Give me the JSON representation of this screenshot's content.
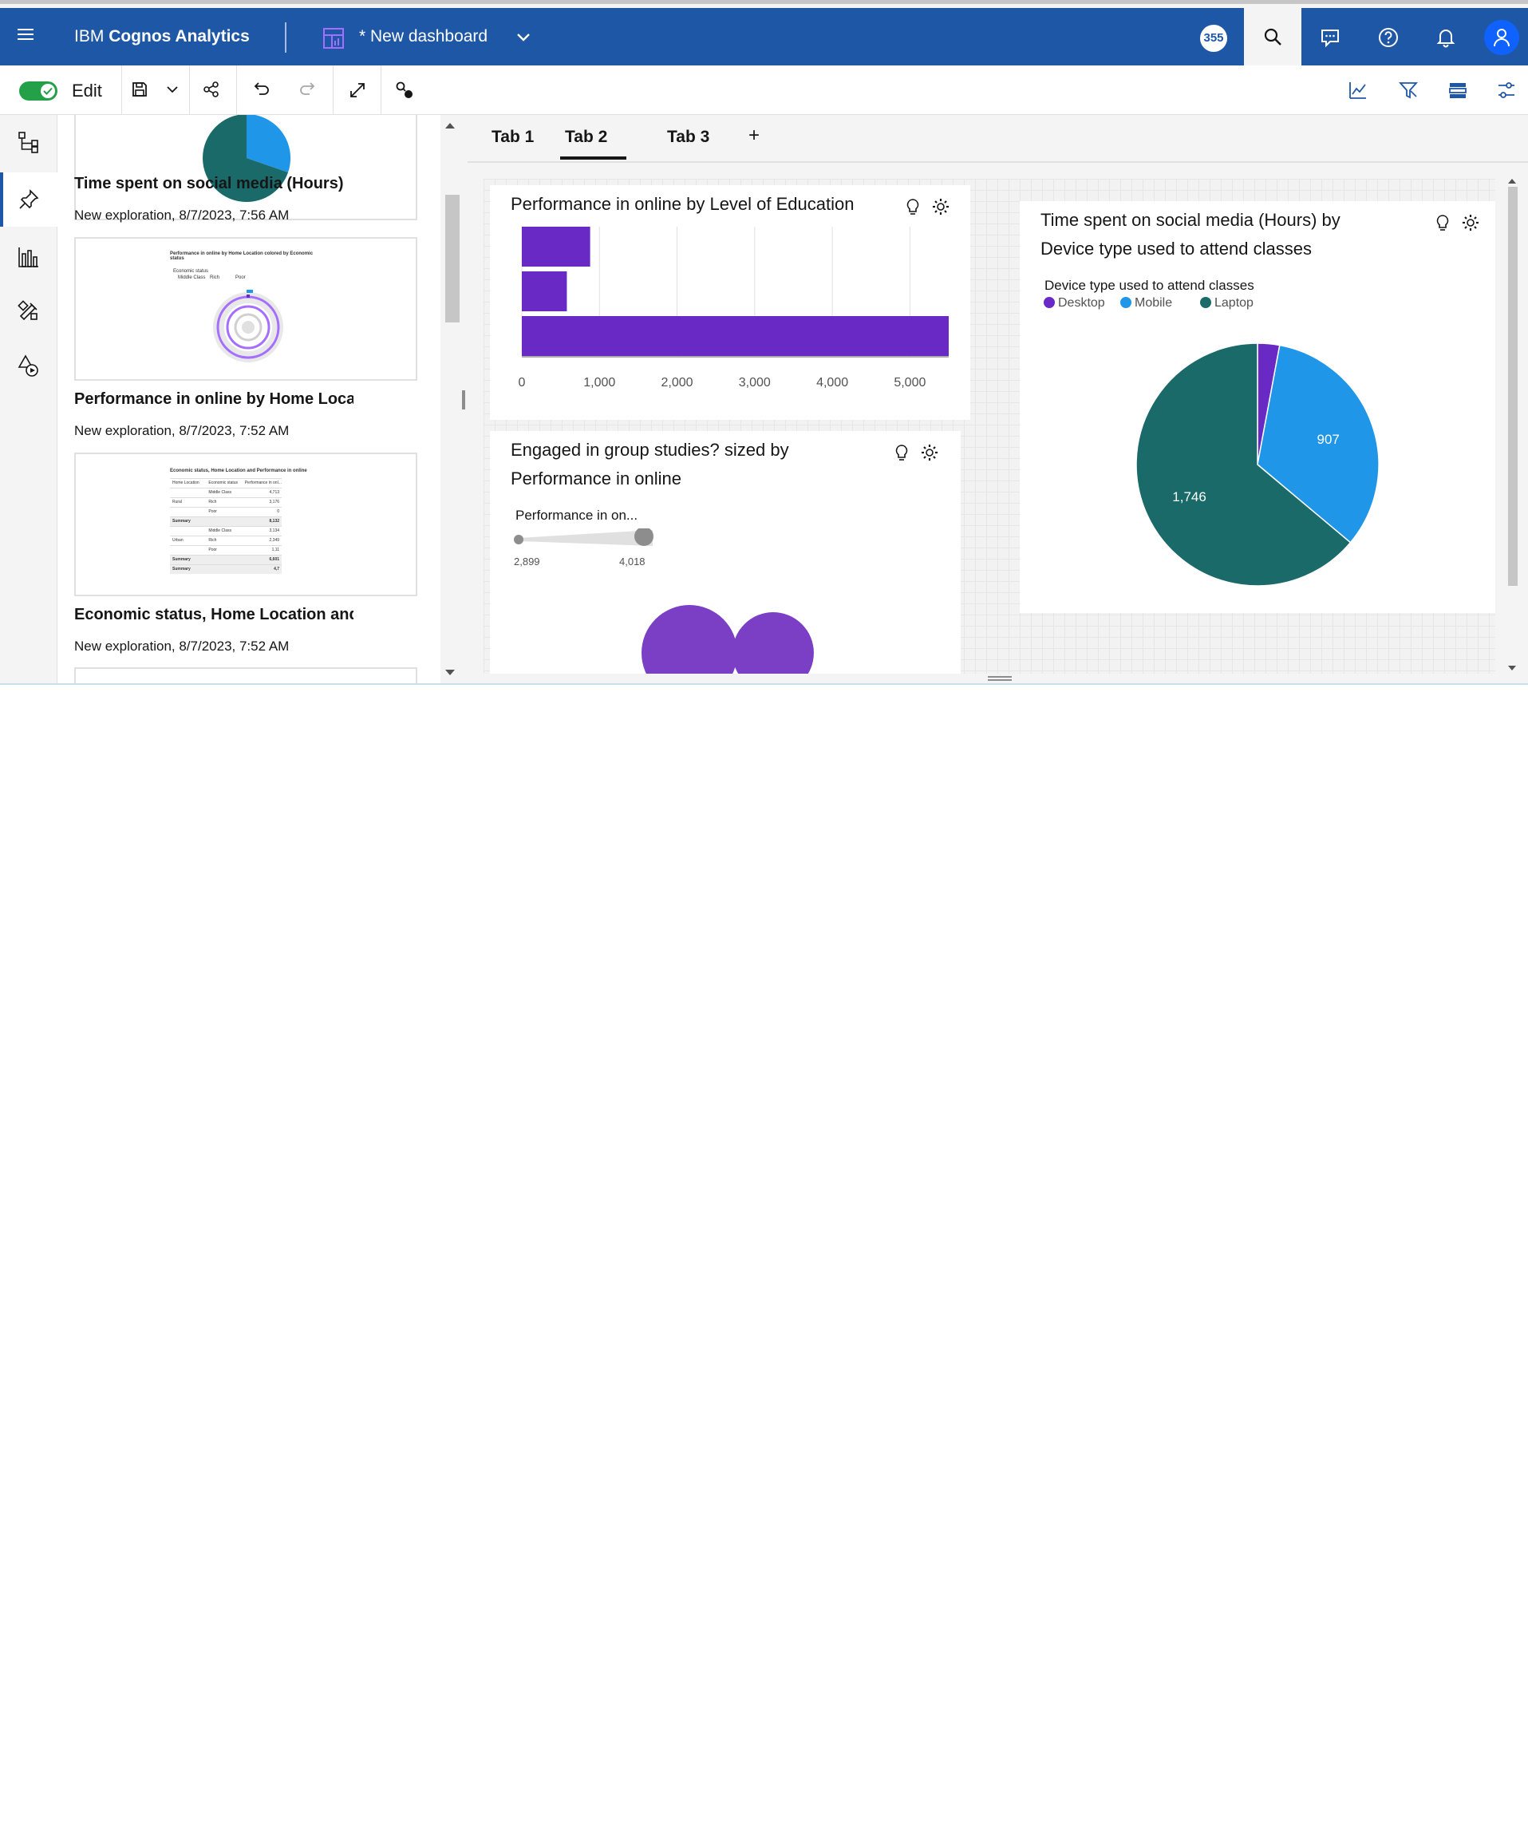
{
  "header": {
    "brand_prefix": "IBM",
    "brand_name": "Cognos Analytics",
    "dashboard_title": "* New dashboard",
    "notification_badge": "355",
    "colors": {
      "bar": "#1f57a7",
      "accent": "#0f62fe"
    }
  },
  "toolbar": {
    "edit_label": "Edit",
    "edit_mode_on": true,
    "icons": [
      "save-icon",
      "chevron-down-icon",
      "share-icon",
      "undo-icon",
      "redo-icon",
      "fullscreen-icon",
      "relationships-icon",
      "insights-icon",
      "filter-icon",
      "data-tray-icon",
      "properties-icon"
    ]
  },
  "rail": {
    "items": [
      "data-tree-icon",
      "pin-icon",
      "visualizations-icon",
      "widgets-icon",
      "shapes-media-icon"
    ],
    "active": "pin-icon"
  },
  "panel": {
    "cards": [
      {
        "title": "Time spent on social media (Hours)",
        "subtitle": "New exploration, 8/7/2023, 7:56 AM"
      },
      {
        "title": "Performance in online by Home Location",
        "subtitle": "New exploration, 8/7/2023, 7:52 AM",
        "thumb_title": "Performance in online by Home Location colored by Economic status",
        "thumb_legend_title": "Economic status",
        "thumb_legend": [
          "Middle Class",
          "Rich",
          "Poor"
        ]
      },
      {
        "title": "Economic status, Home Location and Performance in online",
        "subtitle": "New exploration, 8/7/2023, 7:52 AM",
        "thumb_title": "Economic status, Home Location and Performance in online",
        "thumb_headers": [
          "Home Location",
          "Economic status",
          "Performance in onl..."
        ],
        "thumb_rows": [
          [
            "",
            "Middle Class",
            "4,713"
          ],
          [
            "Rural",
            "Rich",
            "3,176"
          ],
          [
            "",
            "Poor",
            "0"
          ],
          [
            "Summary",
            "",
            "8,132"
          ],
          [
            "",
            "Middle Class",
            "3,134"
          ],
          [
            "Urban",
            "Rich",
            "2,349"
          ],
          [
            "",
            "Poor",
            "1,11"
          ],
          [
            "Summary",
            "",
            "6,601"
          ],
          [
            "Summary",
            "",
            "4,7"
          ]
        ]
      }
    ]
  },
  "tabs": [
    {
      "label": "Tab 1",
      "active": false
    },
    {
      "label": "Tab 2",
      "active": true
    },
    {
      "label": "Tab 3",
      "active": false
    }
  ],
  "tab_add_label": "+",
  "widgets": {
    "bar": {
      "title": "Performance in online by Level of Education"
    },
    "bubble": {
      "title_line1": "Engaged in group studies? sized by",
      "title_line2": "Performance in online",
      "slider_label": "Performance in on...",
      "slider_min": "2,899",
      "slider_max": "4,018"
    },
    "pie": {
      "title_line1": "Time spent on social media (Hours) by",
      "title_line2": "Device type used to attend classes",
      "legend_title": "Device type used to attend classes",
      "legend": [
        {
          "name": "Desktop",
          "color": "#6929c4"
        },
        {
          "name": "Mobile",
          "color": "#1f96e8"
        },
        {
          "name": "Laptop",
          "color": "#1a6a6a"
        }
      ]
    }
  },
  "chart_data": [
    {
      "type": "bar",
      "orientation": "horizontal",
      "title": "Performance in online by Level of Education",
      "categories": [
        "",
        "",
        ""
      ],
      "values": [
        880,
        580,
        5500
      ],
      "xlim": [
        0,
        5500
      ],
      "x_ticks": [
        "0",
        "1,000",
        "2,000",
        "3,000",
        "4,000",
        "5,000"
      ],
      "x_tick_values": [
        0,
        1000,
        2000,
        3000,
        4000,
        5000
      ],
      "color": "#6929c4",
      "grid": true
    },
    {
      "type": "pie",
      "title": "Time spent on social media (Hours) by Device type used to attend classes",
      "labels": [
        "Desktop",
        "Mobile",
        "Laptop"
      ],
      "values": [
        80,
        907,
        1746
      ],
      "data_labels": [
        "",
        "907",
        "1,746"
      ],
      "colors": [
        "#6929c4",
        "#1f96e8",
        "#1a6a6a"
      ],
      "legend_position": "top-left"
    },
    {
      "type": "scatter",
      "title": "Engaged in group studies? sized by Performance in online",
      "sizes": [
        4018,
        2899
      ],
      "color": "#7b3fc6"
    }
  ]
}
